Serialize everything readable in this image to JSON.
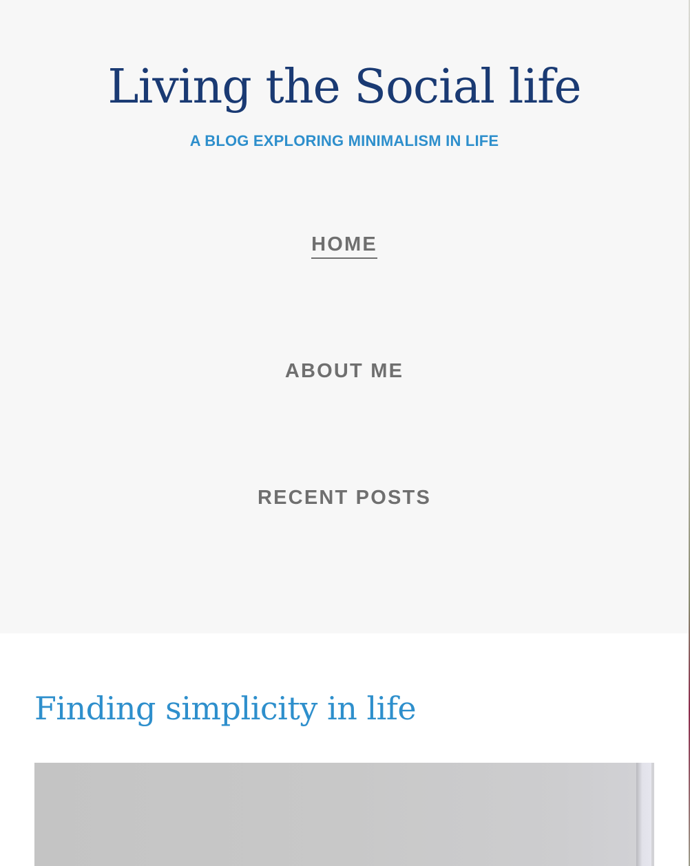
{
  "site": {
    "title": "Living the Social life",
    "tagline": "A BLOG EXPLORING MINIMALISM IN LIFE"
  },
  "nav": {
    "items": [
      {
        "label": "HOME",
        "active": true
      },
      {
        "label": "ABOUT ME",
        "active": false
      },
      {
        "label": "RECENT POSTS",
        "active": false
      }
    ]
  },
  "post": {
    "title": "Finding simplicity in life"
  },
  "colors": {
    "title": "#1a3a73",
    "accent": "#2e8fcc",
    "nav": "#6f6f6f",
    "header_bg": "#f7f7f7"
  }
}
